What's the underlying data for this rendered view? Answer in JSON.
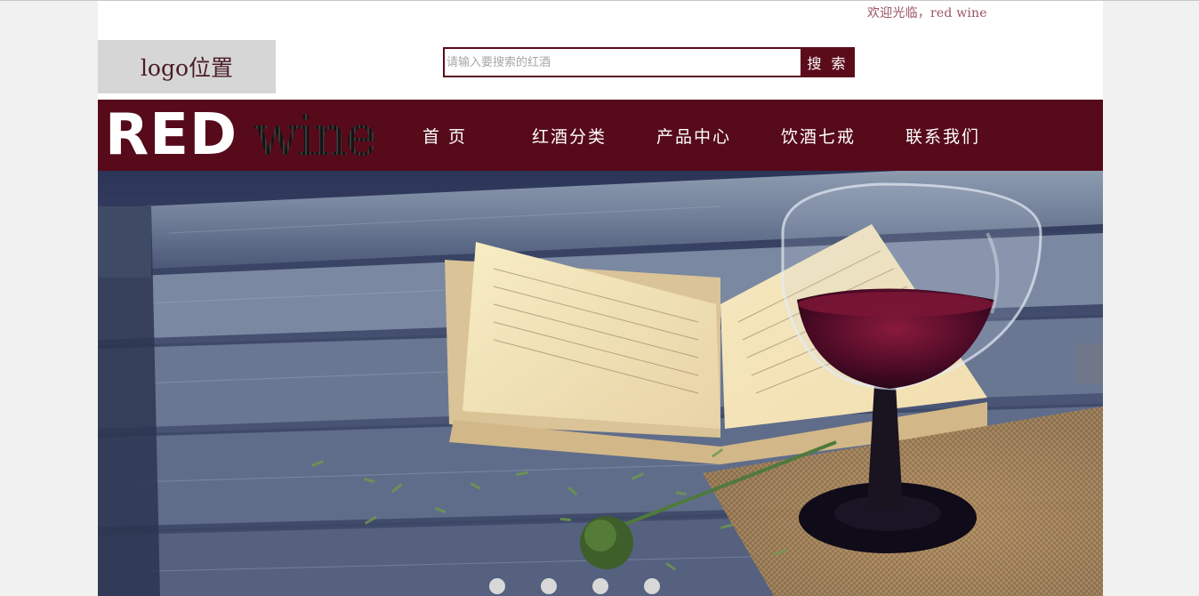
{
  "header": {
    "welcome_text": "欢迎光临，red wine",
    "logo_placeholder": "logo位置"
  },
  "search": {
    "placeholder": "请输入要搜索的红酒",
    "value": "",
    "button_label": "搜 索"
  },
  "brand": {
    "red": "RED",
    "wine": "wine"
  },
  "nav": {
    "items": [
      {
        "label": "首 页"
      },
      {
        "label": "红酒分类"
      },
      {
        "label": "产品中心"
      },
      {
        "label": "饮酒七戒"
      },
      {
        "label": "联系我们"
      }
    ]
  },
  "carousel": {
    "slide_count": 4,
    "active_index": 0
  },
  "colors": {
    "brand": "#560a1a",
    "accent": "#5b0c1b",
    "welcome_text": "#9a5560"
  }
}
